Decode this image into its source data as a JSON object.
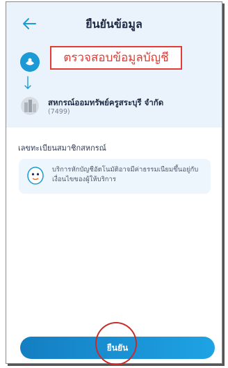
{
  "header": {
    "title": "ยืนยันข้อมูล",
    "back_icon": "arrow-left-icon"
  },
  "annotation": {
    "text": "ตรวจสอบข้อมูลบัญชี",
    "color": "#e23b33"
  },
  "cooperative": {
    "name": "สหกรณ์ออมทรัพย์ครูสระบุรี จำกัด",
    "code": "(7499)"
  },
  "member_section": {
    "label": "เลขทะเบียนสมาชิกสหกรณ์"
  },
  "notice": {
    "icon": "mascot-icon",
    "text": "บริการหักบัญชีอัตโนมัติอาจมีค่าธรรมเนียมขึ้นอยู่กับเงื่อนไขของผู้ให้บริการ"
  },
  "footer": {
    "confirm_label": "ยืนยัน"
  },
  "colors": {
    "accent": "#1b9ad6",
    "button_start": "#147ec2",
    "button_end": "#1ea3e4",
    "highlight": "#c92a2a"
  }
}
